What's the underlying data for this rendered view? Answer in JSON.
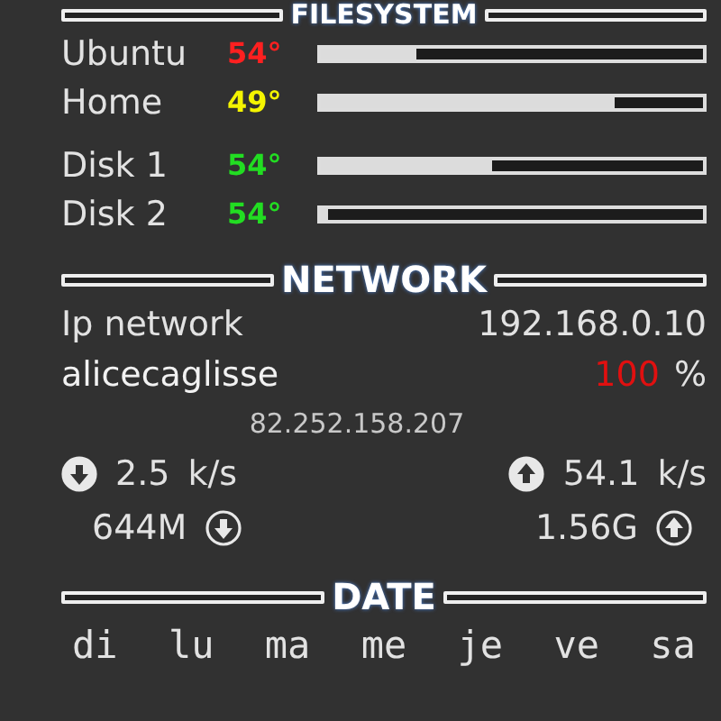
{
  "filesystem": {
    "title": "FILESYSTEM",
    "disks": [
      {
        "name": "Ubuntu",
        "temp": "54°",
        "color": "#ff2020",
        "level": 0.25
      },
      {
        "name": "Home",
        "temp": "49°",
        "color": "#f4f400",
        "level": 0.77
      },
      {
        "name": "Disk 1",
        "temp": "54°",
        "color": "#22dd22",
        "level": 0.45
      },
      {
        "name": "Disk 2",
        "temp": "54°",
        "color": "#22dd22",
        "level": 0.02
      }
    ]
  },
  "network": {
    "title": "NETWORK",
    "ip_label": "Ip network",
    "ip": "192.168.0.10",
    "wifi_name": "alicecaglisse",
    "signal_value": "100",
    "signal_unit": "%",
    "public_ip": "82.252.158.207",
    "download": {
      "speed": "2.5",
      "unit": "k/s",
      "total": "644M"
    },
    "upload": {
      "speed": "54.1",
      "unit": "k/s",
      "total": "1.56G"
    }
  },
  "date": {
    "title": "DATE",
    "weekdays": [
      "di",
      "lu",
      "ma",
      "me",
      "je",
      "ve",
      "sa"
    ]
  }
}
